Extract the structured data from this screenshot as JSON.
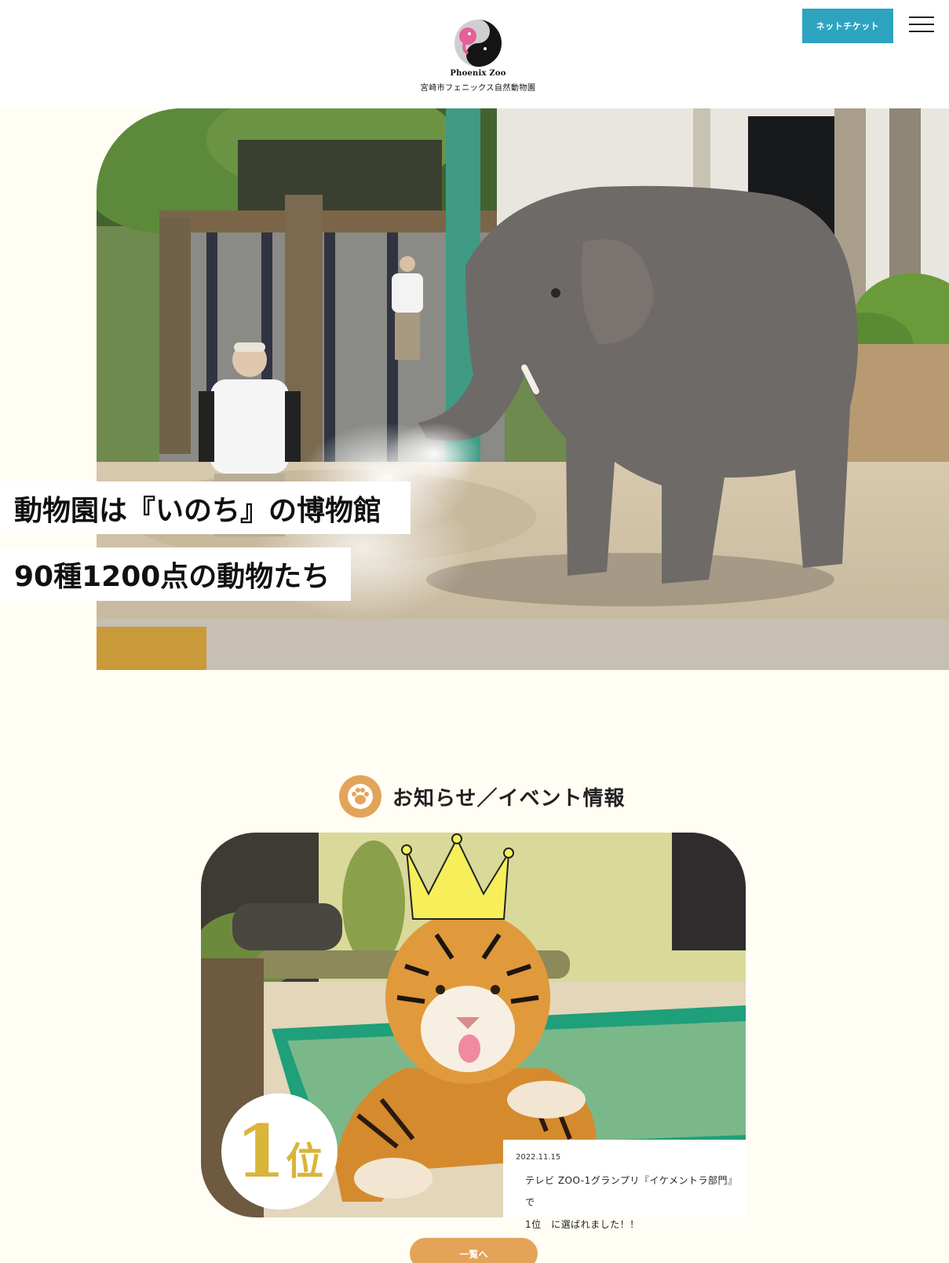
{
  "header": {
    "logo_en": "Phoenix Zoo",
    "logo_jp": "宮崎市フェニックス自然動物園",
    "ticket_label": "ネットチケット",
    "menu_icon": "hamburger-menu-icon"
  },
  "hero": {
    "caption_1": "動物園は『いのち』の博物館",
    "caption_2": "90種1200点の動物たち",
    "image": "elephant-spraying-water-photo"
  },
  "news": {
    "title": "お知らせ／イベント情報",
    "icon": "paw-icon",
    "image": "tiger-with-crown-photo",
    "rank_number": "1",
    "rank_unit": "位",
    "date": "2022.11.15",
    "text_line_1": "テレビ ZOO-1グランプリ『イケメントラ部門』で",
    "text_line_2": "1位　に選ばれました！！",
    "more_label": "一覧へ"
  },
  "colors": {
    "accent_orange": "#e3a45a",
    "ticket_blue": "#2ea3c0",
    "background_cream": "#fffdf4",
    "rank_gold": "#d9b53a"
  }
}
